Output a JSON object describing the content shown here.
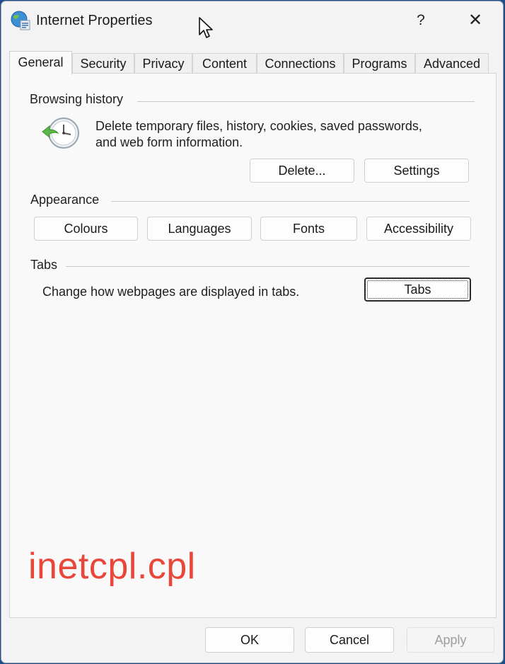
{
  "window": {
    "title": "Internet Properties",
    "help_glyph": "?",
    "close_glyph": "✕"
  },
  "tabs": [
    {
      "label": "General",
      "active": true
    },
    {
      "label": "Security",
      "active": false
    },
    {
      "label": "Privacy",
      "active": false
    },
    {
      "label": "Content",
      "active": false
    },
    {
      "label": "Connections",
      "active": false
    },
    {
      "label": "Programs",
      "active": false
    },
    {
      "label": "Advanced",
      "active": false
    }
  ],
  "browsing_history": {
    "label": "Browsing history",
    "description_line1": "Delete temporary files, history, cookies, saved passwords,",
    "description_line2": "and web form information.",
    "delete_label": "Delete...",
    "settings_label": "Settings"
  },
  "appearance": {
    "label": "Appearance",
    "colours_label": "Colours",
    "languages_label": "Languages",
    "fonts_label": "Fonts",
    "accessibility_label": "Accessibility"
  },
  "tabs_section": {
    "label": "Tabs",
    "description": "Change how webpages are displayed in tabs.",
    "tabs_button_label": "Tabs"
  },
  "overlay": {
    "caption": "inetcpl.cpl",
    "color": "#e8473a"
  },
  "footer": {
    "ok_label": "OK",
    "cancel_label": "Cancel",
    "apply_label": "Apply"
  },
  "icons": {
    "app": "internet-globe-icon",
    "history": "history-clock-icon",
    "cursor": "mouse-cursor-icon"
  }
}
